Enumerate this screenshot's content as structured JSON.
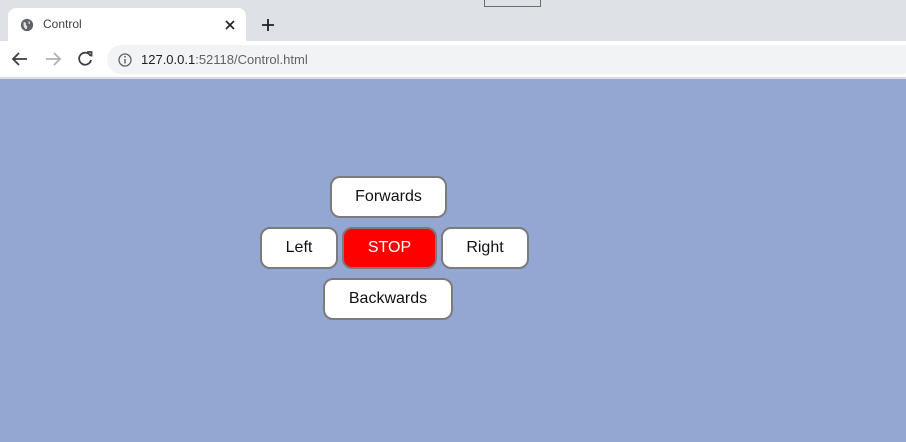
{
  "browser": {
    "tab": {
      "title": "Control",
      "favicon": "globe-icon",
      "close": "close-icon"
    },
    "new_tab": "plus-icon",
    "nav": {
      "back": "arrow-left-icon",
      "forward": "arrow-right-icon",
      "reload": "reload-icon"
    },
    "omnibox": {
      "info_icon": "info-icon",
      "url_host": "127.0.0.1",
      "url_rest": ":52118/Control.html"
    }
  },
  "controls": {
    "forwards": "Forwards",
    "left": "Left",
    "stop": "STOP",
    "right": "Right",
    "backwards": "Backwards"
  },
  "colors": {
    "page_background": "#93a7d2",
    "button_background": "#ffffff",
    "button_border": "#7b7b7b",
    "stop_background": "#ff0000",
    "stop_text": "#ffffff"
  }
}
